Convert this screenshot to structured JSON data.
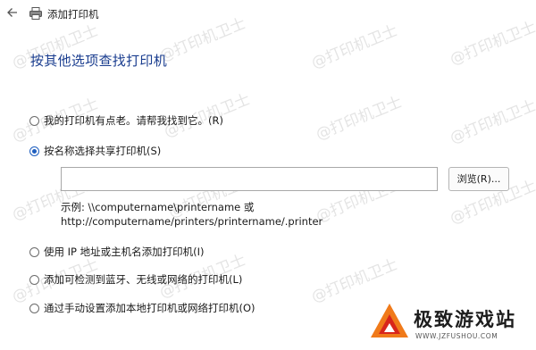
{
  "window": {
    "title": "添加打印机"
  },
  "page": {
    "heading": "按其他选项查找打印机"
  },
  "options": [
    {
      "label": "我的打印机有点老。请帮我找到它。(R)",
      "checked": false
    },
    {
      "label": "按名称选择共享打印机(S)",
      "checked": true
    },
    {
      "label": "使用 IP 地址或主机名添加打印机(I)",
      "checked": false
    },
    {
      "label": "添加可检测到蓝牙、无线或网络的打印机(L)",
      "checked": false
    },
    {
      "label": "通过手动设置添加本地打印机或网络打印机(O)",
      "checked": false
    }
  ],
  "share_name": {
    "value": "",
    "browse_label": "浏览(R)...",
    "example_line1": "示例: \\\\computername\\printername 或",
    "example_line2": "http://computername/printers/printername/.printer"
  },
  "watermark": {
    "text": "@打印机卫士"
  },
  "branding": {
    "name": "极致游戏站",
    "url": "WWW.JZFUSHOU.COM"
  },
  "colors": {
    "accent": "#1f5fbf",
    "heading": "#1a3d8f",
    "logo_orange": "#f07a1a",
    "logo_red": "#d8251b"
  }
}
